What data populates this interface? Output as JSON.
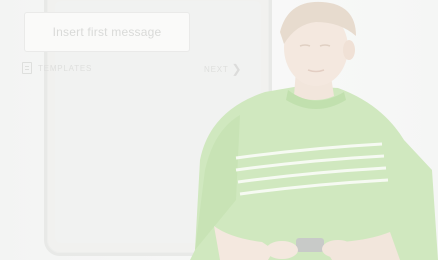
{
  "phone": {
    "message_placeholder": "Insert first message",
    "templates_label": "TEMPLATES",
    "next_label": "NEXT",
    "icons": {
      "templates": "document-icon",
      "next": "chevron-right-icon"
    }
  },
  "photo": {
    "subject": "teen-with-phone",
    "shirt_color": "#a8d68e",
    "stripe_color": "#f0f6ec",
    "skin_color": "#e8d2c2",
    "hair_color": "#d6c3ae"
  }
}
